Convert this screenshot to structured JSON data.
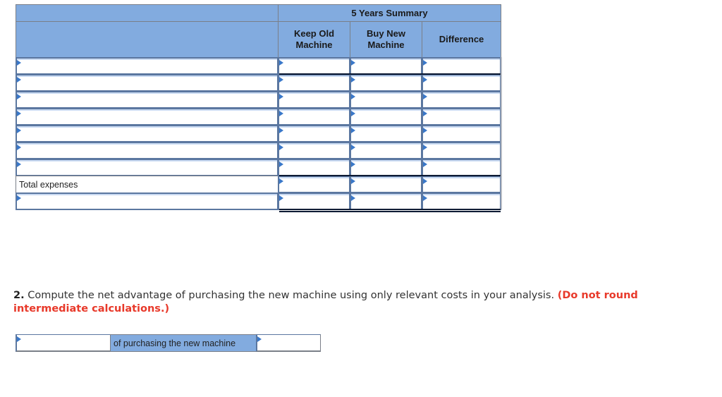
{
  "table": {
    "group_header": "5 Years Summary",
    "columns": [
      {
        "key": "label",
        "header": ""
      },
      {
        "key": "keep_old",
        "header": "Keep Old Machine"
      },
      {
        "key": "buy_new",
        "header": "Buy New Machine"
      },
      {
        "key": "difference",
        "header": "Difference"
      }
    ],
    "rows": [
      {
        "label": "",
        "keep_old": "",
        "buy_new": "",
        "difference": ""
      },
      {
        "label": "",
        "keep_old": "",
        "buy_new": "",
        "difference": ""
      },
      {
        "label": "",
        "keep_old": "",
        "buy_new": "",
        "difference": ""
      },
      {
        "label": "",
        "keep_old": "",
        "buy_new": "",
        "difference": ""
      },
      {
        "label": "",
        "keep_old": "",
        "buy_new": "",
        "difference": ""
      },
      {
        "label": "",
        "keep_old": "",
        "buy_new": "",
        "difference": ""
      },
      {
        "label": "",
        "keep_old": "",
        "buy_new": "",
        "difference": ""
      },
      {
        "label": "Total expenses",
        "keep_old": "",
        "buy_new": "",
        "difference": ""
      },
      {
        "label": "",
        "keep_old": "",
        "buy_new": "",
        "difference": ""
      }
    ]
  },
  "question2": {
    "number": "2.",
    "text": " Compute the net advantage of purchasing the new machine using only relevant costs in your analysis. ",
    "note": "(Do not round intermediate calculations.)",
    "answer_row": {
      "select_value": "",
      "label": "of purchasing the new machine",
      "amount_value": ""
    }
  },
  "colors": {
    "header_blue": "#82abdf",
    "input_border": "#5b77a0",
    "note_red": "#e8392a"
  }
}
